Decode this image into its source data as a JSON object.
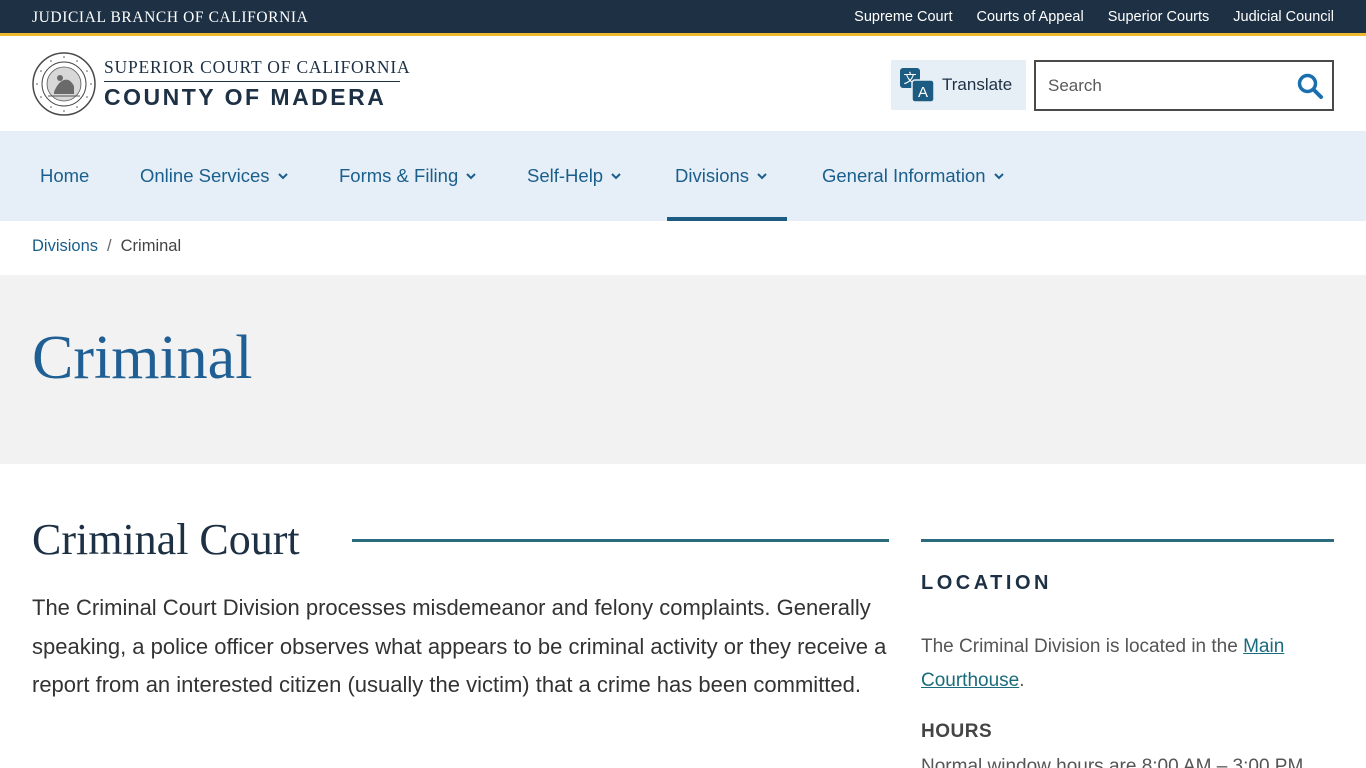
{
  "topbar": {
    "brand": "JUDICIAL BRANCH OF CALIFORNIA",
    "links": [
      "Supreme Court",
      "Courts of Appeal",
      "Superior Courts",
      "Judicial Council"
    ]
  },
  "header": {
    "court_line1": "SUPERIOR COURT OF CALIFORNIA",
    "court_line2": "COUNTY OF MADERA",
    "seal_text": "JUDICIAL BRANCH OF CALIFORNIA",
    "translate_label": "Translate",
    "search_placeholder": "Search"
  },
  "nav": {
    "items": [
      {
        "label": "Home"
      },
      {
        "label": "Online Services"
      },
      {
        "label": "Forms & Filing"
      },
      {
        "label": "Self-Help"
      },
      {
        "label": "Divisions"
      },
      {
        "label": "General Information"
      }
    ],
    "active": "Divisions"
  },
  "breadcrumb": {
    "parent": "Divisions",
    "separator": "/",
    "current": "Criminal"
  },
  "hero": {
    "title": "Criminal"
  },
  "main": {
    "heading": "Criminal Court",
    "paragraph": "The Criminal Court Division processes misdemeanor and felony complaints. Generally speaking, a police officer observes what appears to be criminal activity or they receive a report from an interested citizen (usually the victim) that a crime has been committed."
  },
  "sidebar": {
    "location_title": "LOCATION",
    "location_text": "The Criminal Division is located in the ",
    "location_link": "Main Courthouse",
    "location_end": ".",
    "hours_title": "HOURS",
    "hours_text": "Normal window hours are 8:00 AM – 3:00 PM"
  },
  "colors": {
    "topbar_bg": "#1d3044",
    "accent_gold": "#f0b82c",
    "nav_bg": "#e6eff8",
    "link_blue": "#1a5f8c",
    "hero_title": "#1f5f93",
    "rule_teal": "#2a6b7c"
  }
}
